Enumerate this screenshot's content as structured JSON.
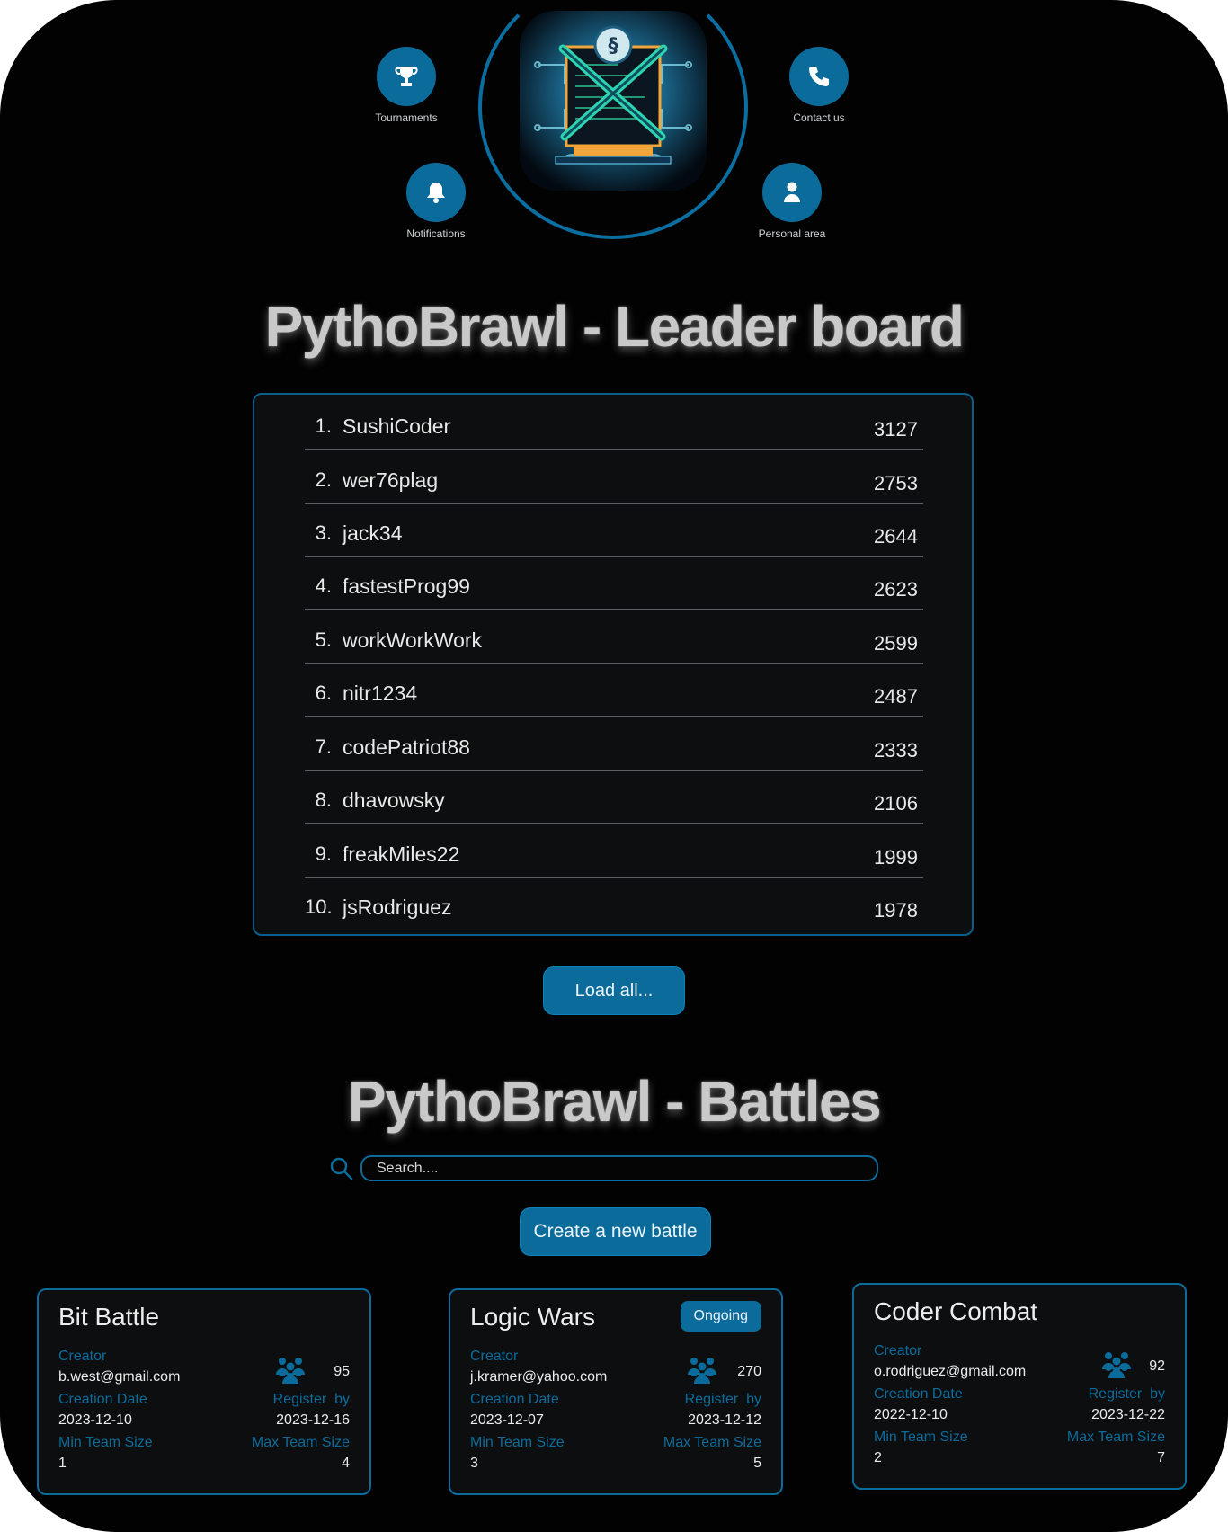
{
  "nav": {
    "tournaments": "Tournaments",
    "contact": "Contact us",
    "notifications": "Notifications",
    "personal": "Personal area"
  },
  "leaderboard": {
    "title": "PythoBrawl - Leader board",
    "entries": [
      {
        "rank": "1.",
        "name": "SushiCoder",
        "score": "3127"
      },
      {
        "rank": "2.",
        "name": "wer76plag",
        "score": "2753"
      },
      {
        "rank": "3.",
        "name": "jack34",
        "score": "2644"
      },
      {
        "rank": "4.",
        "name": "fastestProg99",
        "score": "2623"
      },
      {
        "rank": "5.",
        "name": "workWorkWork",
        "score": "2599"
      },
      {
        "rank": "6.",
        "name": "nitr1234",
        "score": "2487"
      },
      {
        "rank": "7.",
        "name": "codePatriot88",
        "score": "2333"
      },
      {
        "rank": "8.",
        "name": "dhavowsky",
        "score": "2106"
      },
      {
        "rank": "9.",
        "name": "freakMiles22",
        "score": "1999"
      },
      {
        "rank": "10.",
        "name": "jsRodriguez",
        "score": "1978"
      }
    ],
    "load_all": "Load all..."
  },
  "battles": {
    "title": "PythoBrawl - Battles",
    "search_placeholder": "Search....",
    "create_button": "Create a new battle",
    "labels": {
      "creator": "Creator",
      "creation_date": "Creation Date",
      "register_by": "Register  by",
      "min_team": "Min Team Size",
      "max_team": "Max Team Size"
    },
    "cards": [
      {
        "name": "Bit Battle",
        "status": "",
        "creator": "b.west@gmail.com",
        "participants": "95",
        "creation_date": "2023-12-10",
        "register_by": "2023-12-16",
        "min_team": "1",
        "max_team": "4"
      },
      {
        "name": "Logic Wars",
        "status": "Ongoing",
        "creator": "j.kramer@yahoo.com",
        "participants": "270",
        "creation_date": "2023-12-07",
        "register_by": "2023-12-12",
        "min_team": "3",
        "max_team": "5"
      },
      {
        "name": "Coder Combat",
        "status": "",
        "creator": "o.rodriguez@gmail.com",
        "participants": "92",
        "creation_date": "2022-12-10",
        "register_by": "2023-12-22",
        "min_team": "2",
        "max_team": "7"
      }
    ]
  },
  "colors": {
    "accent": "#0b6c9b",
    "background": "#020202",
    "panel": "#0d0e0f"
  }
}
